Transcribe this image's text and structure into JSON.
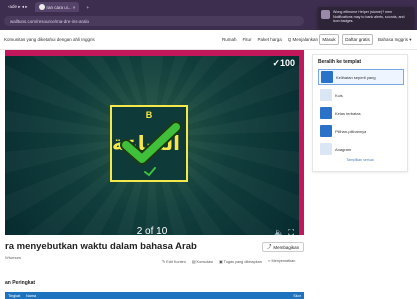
{
  "browser": {
    "tabs": [
      {
        "label": "‹ade ▸ ◂ ▸"
      },
      {
        "label": "ran cara ui... ×",
        "active": true
      },
      {
        "label": "+"
      }
    ],
    "address": "walltuns.com/resource/ma-dre-ins-aralo"
  },
  "notification": {
    "text": "Wong eithrome Helper (stome)? men Notifications may to bank alerts, sounds, and icon badges."
  },
  "nav": {
    "breadcrumb": "Komunitas yang diketahui dengan ahli Inggris",
    "links": [
      "Rumah",
      "Fitur",
      "Paket harga",
      "Q Menjalankan"
    ],
    "login": "Masuk",
    "signup": "Daftar gratis",
    "language": "Bahasa Inggris ▾"
  },
  "activity": {
    "score": "✓100",
    "card_top_letter": "B",
    "card_word": "الساعة",
    "pager": "2 of 10",
    "title": "ra menyebutkan waktu dalam bahasa Arab",
    "author": "Wiweses",
    "share_label": "Membagikan",
    "actions": [
      "Edit Konten",
      "Konsolasi",
      "Tugas yang ditetapkan",
      "Menyematkan"
    ]
  },
  "templates": {
    "title": "Beralih ke templat",
    "items": [
      {
        "label": "Kelihatan seperti yang"
      },
      {
        "label": "Kuis"
      },
      {
        "label": "Kelas terbatas"
      },
      {
        "label": "Pilihan-pilihannya"
      },
      {
        "label": "Anagram"
      }
    ],
    "show_all": "Tampilkan semua"
  },
  "leaderboard": {
    "title": "an Peringkat",
    "columns": {
      "rank": "Tingkat",
      "name": "Nama",
      "score": "Skor"
    }
  },
  "colors": {
    "frame": "#c2185b",
    "card_border": "#f5e84a",
    "check": "#3fbf3a",
    "header": "#3d2d4f",
    "accent_blue": "#1e73be"
  }
}
